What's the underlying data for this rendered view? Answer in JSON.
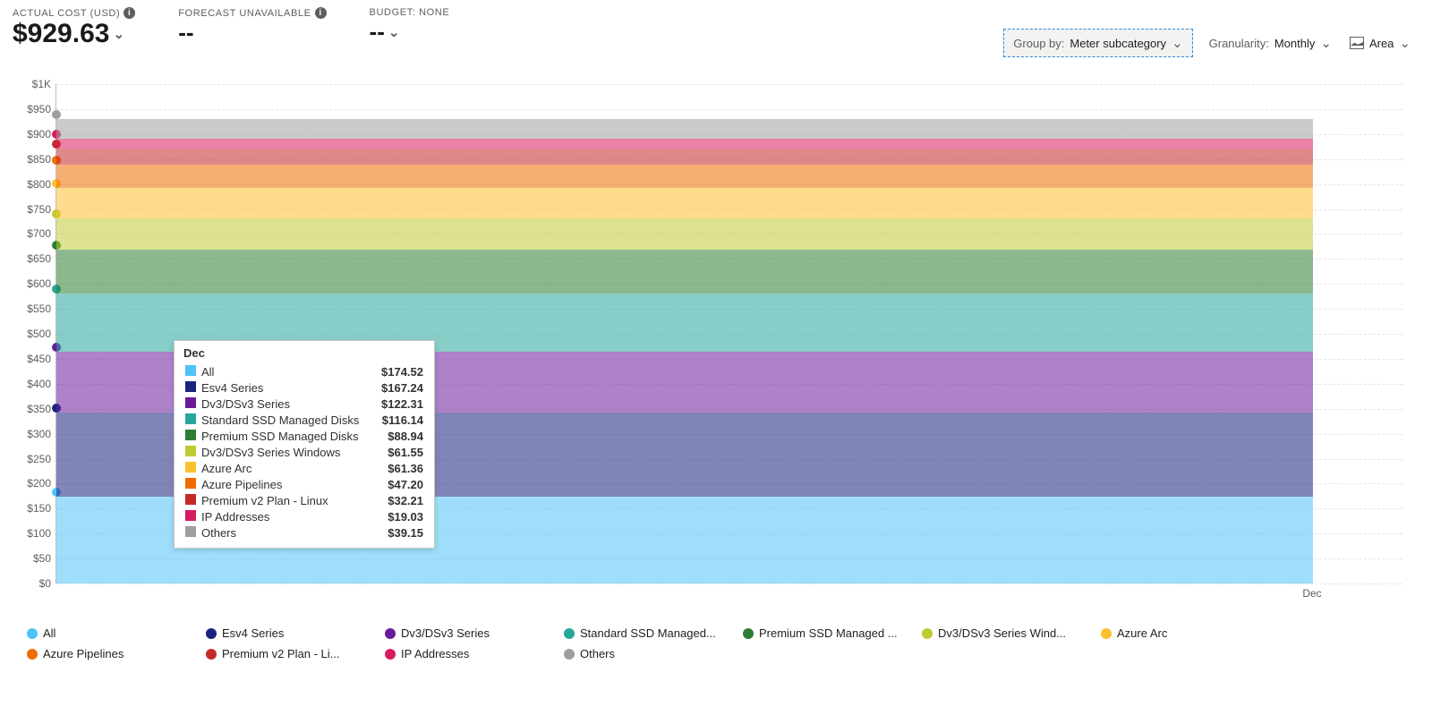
{
  "summary": {
    "actual_label": "ACTUAL COST (USD)",
    "actual_value": "$929.63",
    "forecast_label": "FORECAST UNAVAILABLE",
    "forecast_value": "--",
    "budget_label": "BUDGET: NONE",
    "budget_value": "--"
  },
  "controls": {
    "groupby_label": "Group by:",
    "groupby_value": "Meter subcategory",
    "granularity_label": "Granularity:",
    "granularity_value": "Monthly",
    "charttype_value": "Area"
  },
  "chart_data": {
    "type": "area",
    "title": "",
    "xlabel": "",
    "ylabel": "",
    "ylim": [
      0,
      1000
    ],
    "yticks": [
      0,
      50,
      100,
      150,
      200,
      250,
      300,
      350,
      400,
      450,
      500,
      550,
      600,
      650,
      700,
      750,
      800,
      850,
      900,
      950,
      1000
    ],
    "ytick_labels": [
      "$0",
      "$50",
      "$100",
      "$150",
      "$200",
      "$250",
      "$300",
      "$350",
      "$400",
      "$450",
      "$500",
      "$550",
      "$600",
      "$650",
      "$700",
      "$750",
      "$800",
      "$850",
      "$900",
      "$950",
      "$1K"
    ],
    "categories": [
      "Dec"
    ],
    "x_month_label": "Dec",
    "series": [
      {
        "name": "All",
        "color": "#4fc3f7",
        "value": 174.52,
        "display": "$174.52"
      },
      {
        "name": "Esv4 Series",
        "color": "#1a237e",
        "value": 167.24,
        "display": "$167.24"
      },
      {
        "name": "Dv3/DSv3 Series",
        "color": "#6a1b9a",
        "value": 122.31,
        "display": "$122.31"
      },
      {
        "name": "Standard SSD Managed Disks",
        "color": "#26a69a",
        "value": 116.14,
        "display": "$116.14"
      },
      {
        "name": "Premium SSD Managed Disks",
        "color": "#2e7d32",
        "value": 88.94,
        "display": "$88.94"
      },
      {
        "name": "Dv3/DSv3 Series Windows",
        "color": "#c0ca33",
        "value": 61.55,
        "display": "$61.55"
      },
      {
        "name": "Azure Arc",
        "color": "#fbc02d",
        "value": 61.36,
        "display": "$61.36"
      },
      {
        "name": "Azure Pipelines",
        "color": "#ef6c00",
        "value": 47.2,
        "display": "$47.20"
      },
      {
        "name": "Premium v2 Plan - Linux",
        "color": "#c62828",
        "value": 32.21,
        "display": "$32.21"
      },
      {
        "name": "IP Addresses",
        "color": "#d81b60",
        "value": 19.03,
        "display": "$19.03"
      },
      {
        "name": "Others",
        "color": "#9e9e9e",
        "value": 39.15,
        "display": "$39.15"
      }
    ],
    "legend": [
      {
        "name": "All",
        "display": "All",
        "color": "#4fc3f7"
      },
      {
        "name": "Esv4 Series",
        "display": "Esv4 Series",
        "color": "#1a237e"
      },
      {
        "name": "Dv3/DSv3 Series",
        "display": "Dv3/DSv3 Series",
        "color": "#6a1b9a"
      },
      {
        "name": "Standard SSD Managed Disks",
        "display": "Standard SSD Managed...",
        "color": "#26a69a"
      },
      {
        "name": "Premium SSD Managed Disks",
        "display": "Premium SSD Managed ...",
        "color": "#2e7d32"
      },
      {
        "name": "Dv3/DSv3 Series Windows",
        "display": "Dv3/DSv3 Series Wind...",
        "color": "#c0ca33"
      },
      {
        "name": "Azure Arc",
        "display": "Azure Arc",
        "color": "#fbc02d"
      },
      {
        "name": "Azure Pipelines",
        "display": "Azure Pipelines",
        "color": "#ef6c00"
      },
      {
        "name": "Premium v2 Plan - Linux",
        "display": "Premium v2 Plan - Li...",
        "color": "#c62828"
      },
      {
        "name": "IP Addresses",
        "display": "IP Addresses",
        "color": "#d81b60"
      },
      {
        "name": "Others",
        "display": "Others",
        "color": "#9e9e9e"
      }
    ]
  }
}
